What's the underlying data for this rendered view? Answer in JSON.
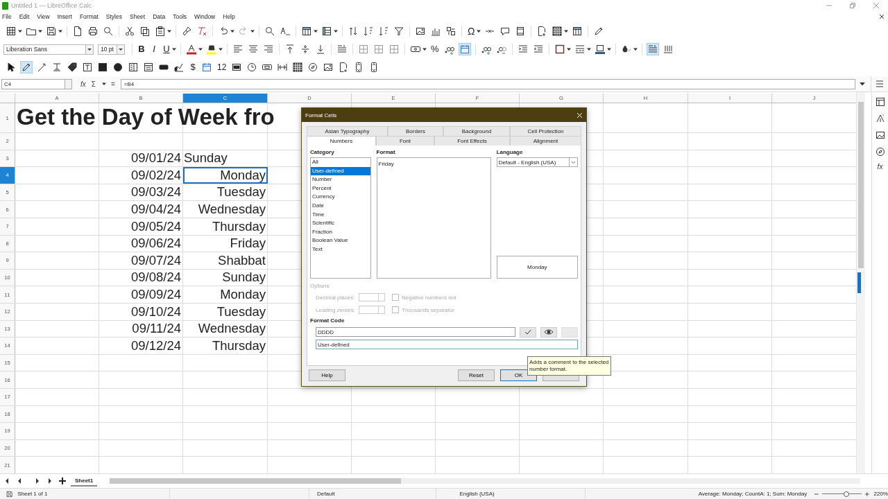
{
  "window": {
    "title": "Untitled 1 — LibreOffice Calc"
  },
  "menu": [
    "File",
    "Edit",
    "View",
    "Insert",
    "Format",
    "Styles",
    "Sheet",
    "Data",
    "Tools",
    "Window",
    "Help"
  ],
  "standard_toolbar": {
    "special_character": "Ω"
  },
  "formatting": {
    "font_name": "Liberation Sans",
    "font_size": "10 pt",
    "bold": "B",
    "italic": "I",
    "underline": "U",
    "percent": "%",
    "number_format_on": true,
    "wrap_text_on": true
  },
  "drawing_toolbar": {
    "currency": "$",
    "numeric_field": "12",
    "draw_mode_on": true
  },
  "formula_bar": {
    "cell_ref": "C4",
    "function_wizard": "fx",
    "sum": "Σ",
    "equals": "=",
    "formula": "=B4"
  },
  "sidebar": {
    "functions": "fx"
  },
  "columns": [
    {
      "label": "A",
      "selected": false
    },
    {
      "label": "B",
      "selected": false
    },
    {
      "label": "C",
      "selected": true
    },
    {
      "label": "D",
      "selected": false
    },
    {
      "label": "E",
      "selected": false
    },
    {
      "label": "F",
      "selected": false
    },
    {
      "label": "G",
      "selected": false
    },
    {
      "label": "H",
      "selected": false
    },
    {
      "label": "I",
      "selected": false
    },
    {
      "label": "J",
      "selected": false
    }
  ],
  "rows": [
    {
      "number": "1",
      "selected": false,
      "title": "Get the Day of Week fro"
    },
    {
      "number": "2",
      "selected": false
    },
    {
      "number": "3",
      "selected": false,
      "date": "09/01/24",
      "day": "Sunday",
      "right_aligned": false
    },
    {
      "number": "4",
      "selected": true,
      "date": "09/02/24",
      "day": "Monday",
      "right_aligned": true
    },
    {
      "number": "5",
      "selected": false,
      "date": "09/03/24",
      "day": "Tuesday",
      "right_aligned": true
    },
    {
      "number": "6",
      "selected": false,
      "date": "09/04/24",
      "day": "Wednesday",
      "right_aligned": true
    },
    {
      "number": "7",
      "selected": false,
      "date": "09/05/24",
      "day": "Thursday",
      "right_aligned": true
    },
    {
      "number": "8",
      "selected": false,
      "date": "09/06/24",
      "day": "Friday",
      "right_aligned": true
    },
    {
      "number": "9",
      "selected": false,
      "date": "09/07/24",
      "day": "Shabbat",
      "right_aligned": true
    },
    {
      "number": "10",
      "selected": false,
      "date": "09/08/24",
      "day": "Sunday",
      "right_aligned": true
    },
    {
      "number": "11",
      "selected": false,
      "date": "09/09/24",
      "day": "Monday",
      "right_aligned": true
    },
    {
      "number": "12",
      "selected": false,
      "date": "09/10/24",
      "day": "Tuesday",
      "right_aligned": true
    },
    {
      "number": "13",
      "selected": false,
      "date": "09/11/24",
      "day": "Wednesday",
      "right_aligned": true
    },
    {
      "number": "14",
      "selected": false,
      "date": "09/12/24",
      "day": "Thursday",
      "right_aligned": true
    },
    {
      "number": "15",
      "selected": false
    },
    {
      "number": "16",
      "selected": false
    },
    {
      "number": "17",
      "selected": false
    },
    {
      "number": "18",
      "selected": false
    },
    {
      "number": "19",
      "selected": false
    },
    {
      "number": "20",
      "selected": false
    },
    {
      "number": "21",
      "selected": false
    }
  ],
  "sheet_tabs": [
    {
      "label": "Sheet1",
      "selected": true
    }
  ],
  "status_bar": {
    "sheet": "Sheet 1 of 1",
    "page_style": "Default",
    "language": "English (USA)",
    "summary": "Average: Monday; CountA: 1; Sum: Monday",
    "zoom": "220%",
    "level": 0.62
  },
  "dialog": {
    "title": "Format Cells",
    "tabs_back": [
      {
        "label": "Asian Typography",
        "selected": false
      },
      {
        "label": "Borders",
        "selected": false
      },
      {
        "label": "Background",
        "selected": false
      },
      {
        "label": "Cell Protection",
        "selected": false
      }
    ],
    "tabs_front": [
      {
        "label": "Numbers",
        "selected": true
      },
      {
        "label": "Font",
        "selected": false
      },
      {
        "label": "Font Effects",
        "selected": false
      },
      {
        "label": "Alignment",
        "selected": false
      }
    ],
    "category": {
      "label": "Category",
      "items": [
        {
          "label": "All",
          "selected": false
        },
        {
          "label": "User-defined",
          "selected": true
        },
        {
          "label": "Number",
          "selected": false
        },
        {
          "label": "Percent",
          "selected": false
        },
        {
          "label": "Currency",
          "selected": false
        },
        {
          "label": "Date",
          "selected": false
        },
        {
          "label": "Time",
          "selected": false
        },
        {
          "label": "Scientific",
          "selected": false
        },
        {
          "label": "Fraction",
          "selected": false
        },
        {
          "label": "Boolean Value",
          "selected": false
        },
        {
          "label": "Text",
          "selected": false
        }
      ]
    },
    "format": {
      "label": "Format",
      "items": [
        {
          "label": "Friday",
          "selected": false
        }
      ]
    },
    "language": {
      "label": "Language",
      "value": "Default - English (USA)"
    },
    "preview": "Monday",
    "options": {
      "label": "Options",
      "disabled": true,
      "decimal_places": "Decimal places:",
      "leading_zeroes": "Leading zeroes:",
      "checkboxes": [
        {
          "label": "Negative numbers red",
          "checked": false
        },
        {
          "label": "Thousands separator",
          "checked": false
        }
      ]
    },
    "format_code": {
      "label": "Format Code",
      "value": "DDDD",
      "comment": "User-defined",
      "buttons": [
        {
          "kind": "add",
          "disabled": false
        },
        {
          "kind": "comment",
          "disabled": false
        },
        {
          "kind": "remove",
          "disabled": true
        }
      ]
    },
    "buttons": [
      {
        "label": "Help",
        "kind": "help",
        "default": false
      },
      {
        "label": "Reset",
        "kind": "reset",
        "default": false
      },
      {
        "label": "OK",
        "kind": "ok",
        "default": true
      },
      {
        "kind": "cancel",
        "default": false
      }
    ]
  },
  "tooltip": "Adds a comment to the selected number format."
}
